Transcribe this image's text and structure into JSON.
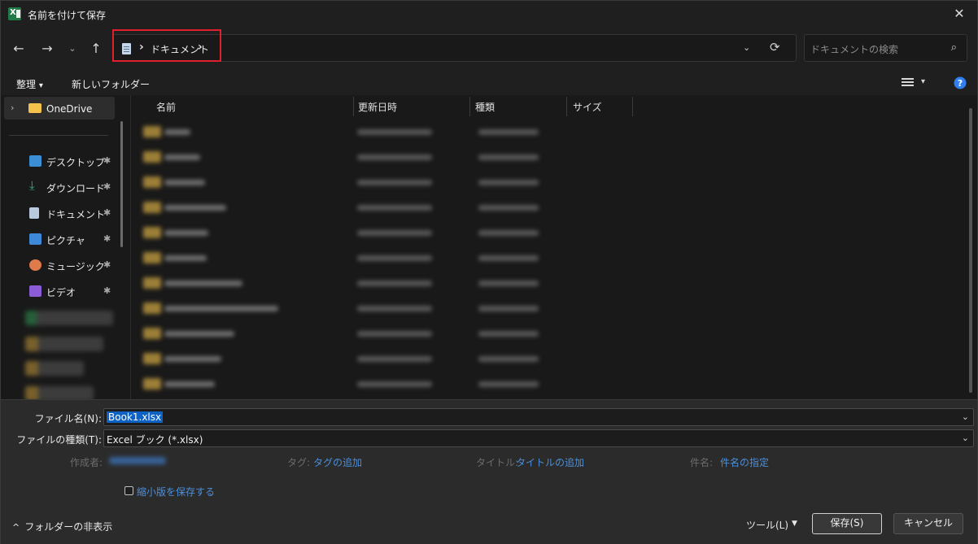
{
  "window": {
    "title": "名前を付けて保存",
    "app_icon": "excel-icon",
    "close_glyph": "✕"
  },
  "nav": {
    "back_glyph": "←",
    "forward_glyph": "→",
    "recent_glyph": "⌄",
    "up_glyph": "↑",
    "breadcrumb": "ドキュメント",
    "separator": "›",
    "refresh_glyph": "⟳",
    "dropdown_glyph": "⌄",
    "search_placeholder": "ドキュメントの検索",
    "search_glyph": "⌕",
    "highlight_color": "#e0202c"
  },
  "toolbar": {
    "organize_label": "整理",
    "organize_dd": "▾",
    "new_folder_label": "新しいフォルダー",
    "view_dd": "▾",
    "help_glyph": "?"
  },
  "sidebar": {
    "onedrive_label": "OneDrive",
    "onedrive_chevron": "›",
    "pin_glyph": "📌",
    "items": [
      {
        "label": "デスクトップ",
        "icon": "desktop-icon",
        "color": "#3b8fd6"
      },
      {
        "label": "ダウンロード",
        "icon": "download-icon",
        "color": "#2fb47a"
      },
      {
        "label": "ドキュメント",
        "icon": "document-icon",
        "color": "#b9c9de"
      },
      {
        "label": "ピクチャ",
        "icon": "pictures-icon",
        "color": "#3d89d8"
      },
      {
        "label": "ミュージック",
        "icon": "music-icon",
        "color": "#e07a4a"
      },
      {
        "label": "ビデオ",
        "icon": "video-icon",
        "color": "#8b5cd6"
      }
    ]
  },
  "columns": {
    "name": "名前",
    "modified": "更新日時",
    "type": "種類",
    "size": "サイズ",
    "sort_glyph": "^"
  },
  "form": {
    "filename_label": "ファイル名(N):",
    "filename_value": "Book1.xlsx",
    "filetype_label": "ファイルの種類(T):",
    "filetype_value": "Excel ブック (*.xlsx)",
    "dd_glyph": "⌄",
    "author_label": "作成者:",
    "tags_label": "タグ:",
    "tags_link": "タグの追加",
    "title_label": "タイトル:",
    "title_link": "タイトルの追加",
    "subject_label": "件名:",
    "subject_link": "件名の指定",
    "thumbnail_label": "縮小版を保存する"
  },
  "footer": {
    "hide_folders": "フォルダーの非表示",
    "hide_caret": "^",
    "tools_label": "ツール(L)",
    "tools_dd": "▼",
    "save_label": "保存(S)",
    "cancel_label": "キャンセル"
  }
}
